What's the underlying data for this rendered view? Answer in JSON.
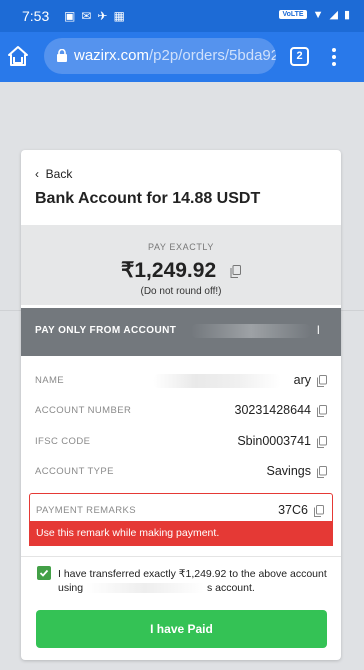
{
  "status_bar": {
    "time": "7:53",
    "network_badge": "VoLTE"
  },
  "browser": {
    "url_domain": "wazirx.com",
    "url_path": "/p2p/orders/5bda92",
    "tab_count": "2"
  },
  "card": {
    "back_label": "Back",
    "title": "Bank Account for 14.88 USDT",
    "pay_exactly_label": "PAY EXACTLY",
    "amount": "₹1,249.92",
    "round_note": "(Do not round off!)",
    "pay_from_label": "PAY ONLY FROM ACCOUNT",
    "pay_from_tail": "l",
    "details": [
      {
        "key": "NAME",
        "value": "ary"
      },
      {
        "key": "ACCOUNT NUMBER",
        "value": "30231428644"
      },
      {
        "key": "IFSC CODE",
        "value": "Sbin0003741"
      },
      {
        "key": "ACCOUNT TYPE",
        "value": "Savings"
      }
    ],
    "remarks": {
      "key": "PAYMENT REMARKS",
      "value": "37C6",
      "warning": "Use this remark while making payment."
    },
    "confirm": {
      "text_before": "I have transferred exactly ₹1,249.92 to the above account using",
      "text_after": "s account.",
      "checked": true
    },
    "paid_button": "I have Paid"
  },
  "colors": {
    "status_bar": "#1d6bd6",
    "browser_bar": "#2979ea",
    "warning_red": "#e53935",
    "paid_green": "#34c255",
    "checkbox_green": "#43a047",
    "from_account_bar": "#73787d"
  }
}
